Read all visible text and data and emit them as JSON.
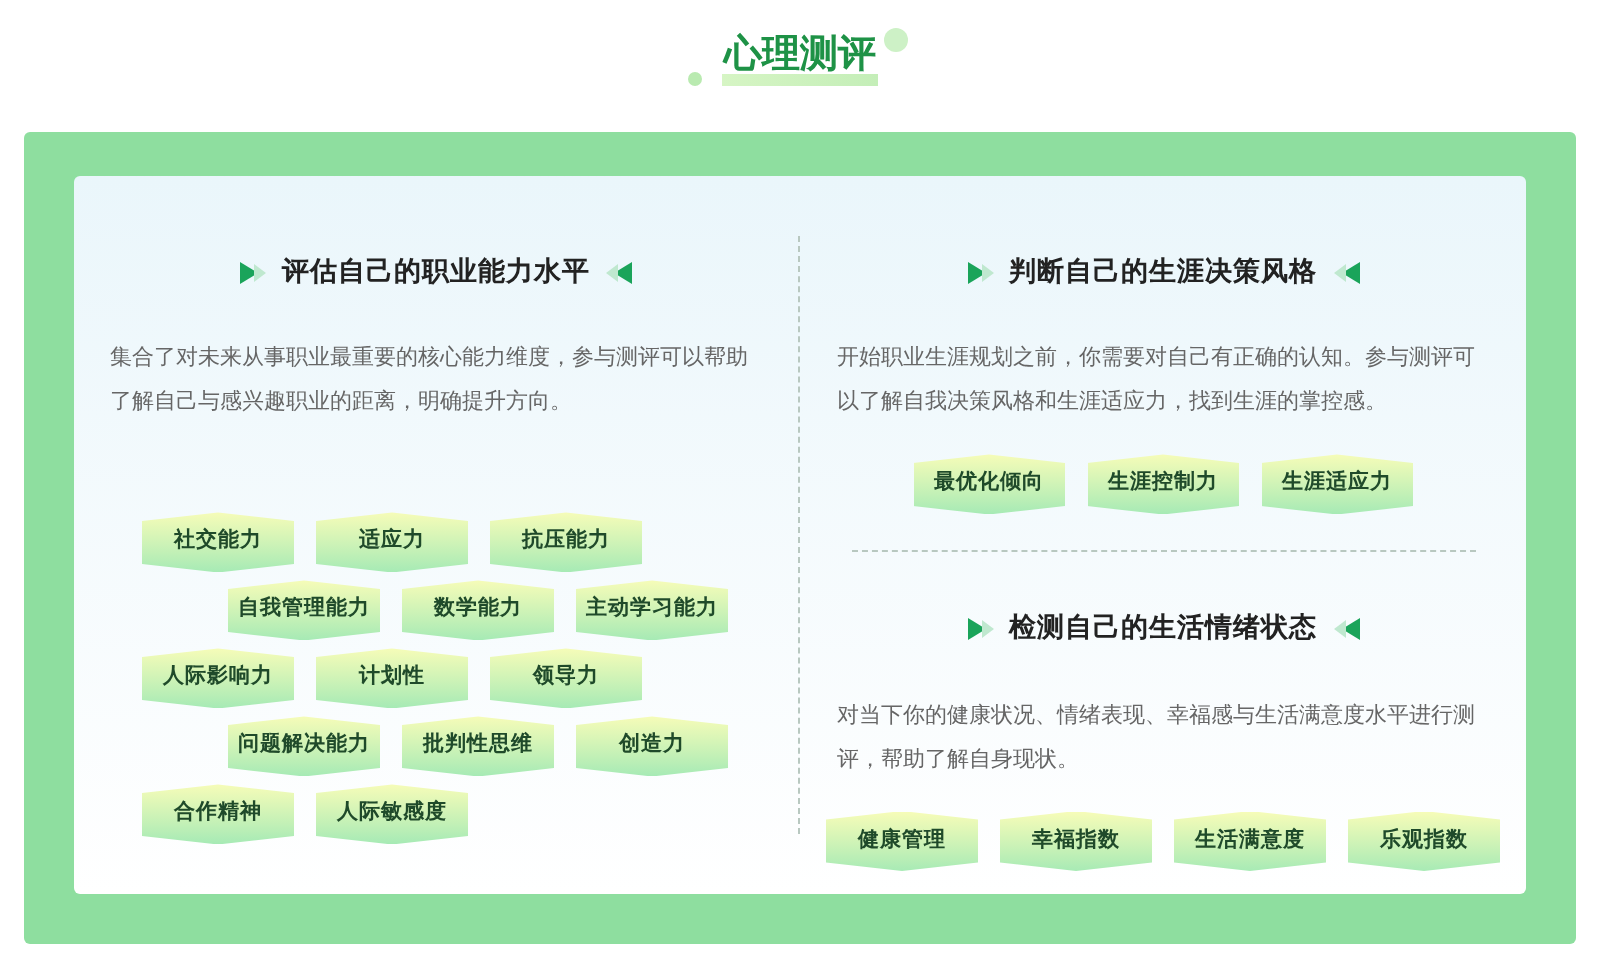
{
  "page_title": "心理测评",
  "left": {
    "heading": "评估自己的职业能力水平",
    "description": "集合了对未来从事职业最重要的核心能力维度，参与测评可以帮助了解自己与感兴趣职业的距离，明确提升方向。",
    "tags": [
      "社交能力",
      "适应力",
      "抗压能力",
      "自我管理能力",
      "数学能力",
      "主动学习能力",
      "人际影响力",
      "计划性",
      "领导力",
      "问题解决能力",
      "批判性思维",
      "创造力",
      "合作精神",
      "人际敏感度"
    ]
  },
  "right_sections": [
    {
      "heading": "判断自己的生涯决策风格",
      "description": "开始职业生涯规划之前，你需要对自己有正确的认知。参与测评可以了解自我决策风格和生涯适应力，找到生涯的掌控感。",
      "tags": [
        "最优化倾向",
        "生涯控制力",
        "生涯适应力"
      ]
    },
    {
      "heading": "检测自己的生活情绪状态",
      "description": "对当下你的健康状况、情绪表现、幸福感与生活满意度水平进行测评，帮助了解自身现状。",
      "tags": [
        "健康管理",
        "幸福指数",
        "生活满意度",
        "乐观指数"
      ]
    }
  ]
}
